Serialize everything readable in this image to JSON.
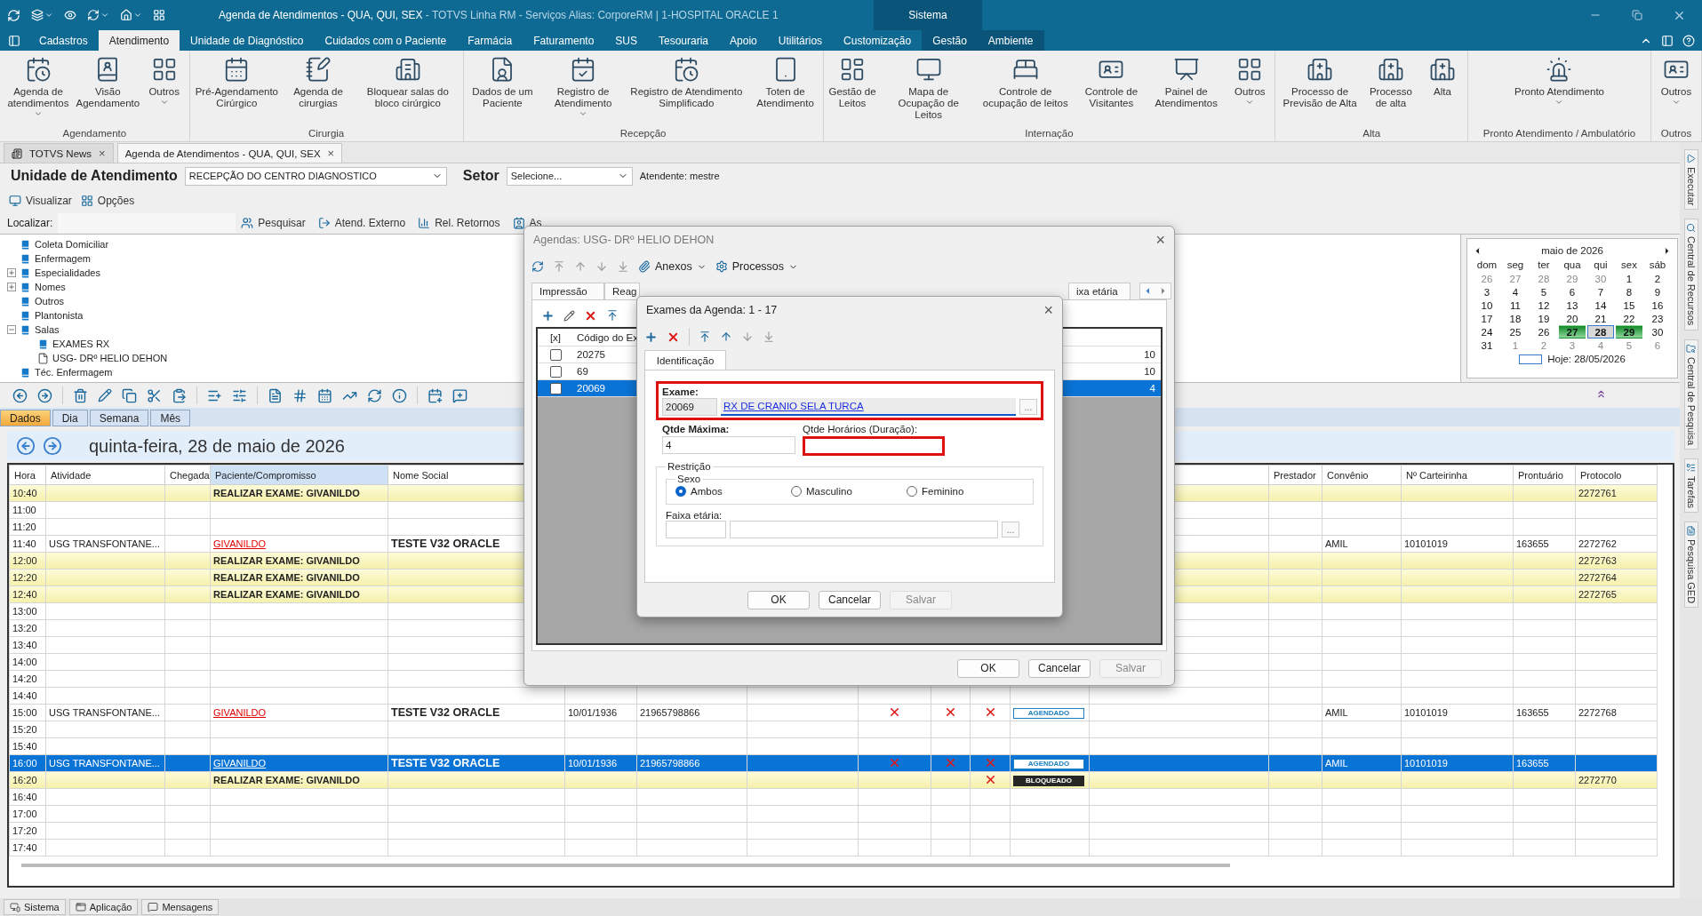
{
  "window": {
    "title": "Agenda de Atendimentos - QUA, QUI, SEX",
    "subtitle": " - TOTVS Linha RM - Serviços  Alias: CorporeRM | 1-HOSPITAL ORACLE 1",
    "context_tab": "Sistema"
  },
  "menu": [
    {
      "label": "Cadastros",
      "selected": false,
      "contextual": false
    },
    {
      "label": "Atendimento",
      "selected": true,
      "contextual": false
    },
    {
      "label": "Unidade de Diagnóstico",
      "selected": false,
      "contextual": false
    },
    {
      "label": "Cuidados com o Paciente",
      "selected": false,
      "contextual": false
    },
    {
      "label": "Farmácia",
      "selected": false,
      "contextual": false
    },
    {
      "label": "Faturamento",
      "selected": false,
      "contextual": false
    },
    {
      "label": "SUS",
      "selected": false,
      "contextual": false
    },
    {
      "label": "Tesouraria",
      "selected": false,
      "contextual": false
    },
    {
      "label": "Apoio",
      "selected": false,
      "contextual": false
    },
    {
      "label": "Utilitários",
      "selected": false,
      "contextual": false
    },
    {
      "label": "Customização",
      "selected": false,
      "contextual": false
    },
    {
      "label": "Gestão",
      "selected": false,
      "contextual": true
    },
    {
      "label": "Ambiente",
      "selected": false,
      "contextual": true
    }
  ],
  "ribbon": [
    {
      "label": "Agendamento",
      "items": [
        {
          "label": "Agenda de atendimentos",
          "dropdown": true
        },
        {
          "label": "Visão Agendamento",
          "dropdown": false
        },
        {
          "label": "Outros",
          "dropdown": true
        }
      ]
    },
    {
      "label": "Cirurgia",
      "items": [
        {
          "label": "Pré-Agendamento Cirúrgico",
          "dropdown": false
        },
        {
          "label": "Agenda de cirurgias",
          "dropdown": false
        },
        {
          "label": "Bloquear salas do bloco cirúrgico",
          "dropdown": false
        }
      ]
    },
    {
      "label": "Recepção",
      "items": [
        {
          "label": "Dados de um Paciente",
          "dropdown": false
        },
        {
          "label": "Registro de Atendimento",
          "dropdown": true
        },
        {
          "label": "Registro de Atendimento Simplificado",
          "dropdown": false
        },
        {
          "label": "Toten de Atendimento",
          "dropdown": false
        }
      ]
    },
    {
      "label": "Internação",
      "items": [
        {
          "label": "Gestão de Leitos",
          "dropdown": false
        },
        {
          "label": "Mapa de Ocupação de Leitos",
          "dropdown": false
        },
        {
          "label": "Controle de ocupação de leitos",
          "dropdown": false
        },
        {
          "label": "Controle de Visitantes",
          "dropdown": false
        },
        {
          "label": "Painel de Atendimentos",
          "dropdown": false
        },
        {
          "label": "Outros",
          "dropdown": true
        }
      ]
    },
    {
      "label": "Alta",
      "items": [
        {
          "label": "Processo de Previsão de Alta",
          "dropdown": false
        },
        {
          "label": "Processo de alta",
          "dropdown": false
        },
        {
          "label": "Alta",
          "dropdown": false
        }
      ]
    },
    {
      "label": "Pronto Atendimento / Ambulatório",
      "items": [
        {
          "label": "Pronto Atendimento",
          "dropdown": true
        }
      ]
    },
    {
      "label": "Outros",
      "items": [
        {
          "label": "Outros",
          "dropdown": true
        }
      ]
    }
  ],
  "doc_tabs": [
    {
      "label": "TOTVS News",
      "selected": false,
      "close": "×"
    },
    {
      "label": "Agenda de Atendimentos - QUA, QUI, SEX",
      "selected": true,
      "close": "×"
    }
  ],
  "unit": {
    "label": "Unidade de Atendimento",
    "value": "RECEPÇÃO DO CENTRO DIAGNOSTICO",
    "setor_label": "Setor",
    "setor_value": "Selecione...",
    "attendant": "Atendente: mestre"
  },
  "view_actions": [
    "Visualizar",
    "Opções"
  ],
  "locate": {
    "label": "Localizar:",
    "actions": [
      "Pesquisar",
      "Atend. Externo",
      "Rel. Retornos",
      "As"
    ]
  },
  "tree": [
    {
      "label": "Coleta Domiciliar",
      "kind": "book"
    },
    {
      "label": "Enfermagem",
      "kind": "book"
    },
    {
      "label": "Especialidades",
      "kind": "book",
      "expandable": true,
      "expanded": false
    },
    {
      "label": "Nomes",
      "kind": "book",
      "expandable": true,
      "expanded": false
    },
    {
      "label": "Outros",
      "kind": "book"
    },
    {
      "label": "Plantonista",
      "kind": "book"
    },
    {
      "label": "Salas",
      "kind": "book",
      "expandable": true,
      "expanded": true,
      "children": [
        {
          "label": "EXAMES RX",
          "kind": "book"
        },
        {
          "label": "USG- DRº HELIO DEHON",
          "kind": "page"
        }
      ]
    },
    {
      "label": "Téc. Enfermagem",
      "kind": "book"
    }
  ],
  "calendar": {
    "month": "maio de 2026",
    "weekdays": [
      "dom",
      "seg",
      "ter",
      "qua",
      "qui",
      "sex",
      "sáb"
    ],
    "weeks": [
      [
        {
          "d": "26",
          "outside": true,
          "marked": false,
          "selected": false
        },
        {
          "d": "27",
          "outside": true,
          "marked": false,
          "selected": false
        },
        {
          "d": "28",
          "outside": true,
          "marked": false,
          "selected": false
        },
        {
          "d": "29",
          "outside": true,
          "marked": false,
          "selected": false
        },
        {
          "d": "30",
          "outside": true,
          "marked": false,
          "selected": false
        },
        {
          "d": "1",
          "outside": false,
          "marked": false,
          "selected": false
        },
        {
          "d": "2",
          "outside": false,
          "marked": false,
          "selected": false
        }
      ],
      [
        {
          "d": "3",
          "outside": false,
          "marked": false,
          "selected": false
        },
        {
          "d": "4",
          "outside": false,
          "marked": false,
          "selected": false
        },
        {
          "d": "5",
          "outside": false,
          "marked": false,
          "selected": false
        },
        {
          "d": "6",
          "outside": false,
          "marked": false,
          "selected": false
        },
        {
          "d": "7",
          "outside": false,
          "marked": false,
          "selected": false
        },
        {
          "d": "8",
          "outside": false,
          "marked": false,
          "selected": false
        },
        {
          "d": "9",
          "outside": false,
          "marked": false,
          "selected": false
        }
      ],
      [
        {
          "d": "10",
          "outside": false,
          "marked": false,
          "selected": false
        },
        {
          "d": "11",
          "outside": false,
          "marked": false,
          "selected": false
        },
        {
          "d": "12",
          "outside": false,
          "marked": false,
          "selected": false
        },
        {
          "d": "13",
          "outside": false,
          "marked": false,
          "selected": false
        },
        {
          "d": "14",
          "outside": false,
          "marked": false,
          "selected": false
        },
        {
          "d": "15",
          "outside": false,
          "marked": false,
          "selected": false
        },
        {
          "d": "16",
          "outside": false,
          "marked": false,
          "selected": false
        }
      ],
      [
        {
          "d": "17",
          "outside": false,
          "marked": false,
          "selected": false
        },
        {
          "d": "18",
          "outside": false,
          "marked": false,
          "selected": false
        },
        {
          "d": "19",
          "outside": false,
          "marked": false,
          "selected": false
        },
        {
          "d": "20",
          "outside": false,
          "marked": false,
          "selected": false
        },
        {
          "d": "21",
          "outside": false,
          "marked": false,
          "selected": false
        },
        {
          "d": "22",
          "outside": false,
          "marked": false,
          "selected": false
        },
        {
          "d": "23",
          "outside": false,
          "marked": false,
          "selected": false
        }
      ],
      [
        {
          "d": "24",
          "outside": false,
          "marked": false,
          "selected": false
        },
        {
          "d": "25",
          "outside": false,
          "marked": false,
          "selected": false
        },
        {
          "d": "26",
          "outside": false,
          "marked": false,
          "selected": false
        },
        {
          "d": "27",
          "outside": false,
          "marked": true,
          "selected": false
        },
        {
          "d": "28",
          "outside": false,
          "marked": false,
          "selected": true
        },
        {
          "d": "29",
          "outside": false,
          "marked": true,
          "selected": false
        },
        {
          "d": "30",
          "outside": false,
          "marked": false,
          "selected": false
        }
      ],
      [
        {
          "d": "31",
          "outside": false,
          "marked": false,
          "selected": false
        },
        {
          "d": "1",
          "outside": true,
          "marked": false,
          "selected": false
        },
        {
          "d": "2",
          "outside": true,
          "marked": false,
          "selected": false
        },
        {
          "d": "3",
          "outside": true,
          "marked": false,
          "selected": false
        },
        {
          "d": "4",
          "outside": true,
          "marked": false,
          "selected": false
        },
        {
          "d": "5",
          "outside": true,
          "marked": false,
          "selected": false
        },
        {
          "d": "6",
          "outside": true,
          "marked": false,
          "selected": false
        }
      ]
    ],
    "today": "Hoje: 28/05/2026"
  },
  "view_tabs": [
    {
      "label": "Dados",
      "selected": true
    },
    {
      "label": "Dia",
      "selected": false
    },
    {
      "label": "Semana",
      "selected": false
    },
    {
      "label": "Mês",
      "selected": false
    }
  ],
  "date_title": "quinta-feira, 28 de maio de 2026",
  "columns": [
    {
      "label": "Hora",
      "sorted": false
    },
    {
      "label": "Atividade",
      "sorted": false
    },
    {
      "label": "Chegada",
      "sorted": false
    },
    {
      "label": "Paciente/Compromisso",
      "sorted": true
    },
    {
      "label": "Nome Social",
      "sorted": false
    },
    {
      "label": "Prestador",
      "sorted": false
    },
    {
      "label": "Convênio",
      "sorted": false
    },
    {
      "label": "Nº Carteirinha",
      "sorted": false
    },
    {
      "label": "Prontuário",
      "sorted": false
    },
    {
      "label": "Protocolo",
      "sorted": false
    }
  ],
  "rows": [
    {
      "hora": "10:40",
      "kind": "blocked",
      "selected": false,
      "paciente": "REALIZAR EXAME: GIVANILDO",
      "protocolo": "2272761"
    },
    {
      "hora": "11:00",
      "kind": "empty",
      "selected": false
    },
    {
      "hora": "11:20",
      "kind": "empty",
      "selected": false
    },
    {
      "hora": "11:40",
      "kind": "patient",
      "selected": false,
      "atividade": "USG TRANSFONTANE...",
      "paciente": "GIVANILDO",
      "nome_social": "TESTE V32 ORACLE",
      "convenio": "AMIL",
      "carteirinha": "10101019",
      "prontuario": "163655",
      "protocolo": "2272762"
    },
    {
      "hora": "12:00",
      "kind": "blocked",
      "selected": false,
      "paciente": "REALIZAR EXAME: GIVANILDO",
      "protocolo": "2272763"
    },
    {
      "hora": "12:20",
      "kind": "blocked",
      "selected": false,
      "paciente": "REALIZAR EXAME: GIVANILDO",
      "protocolo": "2272764"
    },
    {
      "hora": "12:40",
      "kind": "blocked",
      "selected": false,
      "paciente": "REALIZAR EXAME: GIVANILDO",
      "protocolo": "2272765"
    },
    {
      "hora": "13:00",
      "kind": "empty",
      "selected": false
    },
    {
      "hora": "13:20",
      "kind": "empty",
      "selected": false
    },
    {
      "hora": "13:40",
      "kind": "empty",
      "selected": false
    },
    {
      "hora": "14:00",
      "kind": "empty",
      "selected": false
    },
    {
      "hora": "14:20",
      "kind": "empty",
      "selected": false
    },
    {
      "hora": "14:40",
      "kind": "empty",
      "selected": false
    },
    {
      "hora": "15:00",
      "kind": "patient",
      "selected": false,
      "atividade": "USG TRANSFONTANE...",
      "paciente": "GIVANILDO",
      "nome_social": "TESTE V32 ORACLE",
      "nascimento": "10/01/1936",
      "telefone": "21965798866",
      "marks": [
        true,
        true,
        true
      ],
      "status": {
        "label": "AGENDADO",
        "kind": "scheduled"
      },
      "convenio": "AMIL",
      "carteirinha": "10101019",
      "prontuario": "163655",
      "protocolo": "2272768"
    },
    {
      "hora": "15:20",
      "kind": "empty",
      "selected": false
    },
    {
      "hora": "15:40",
      "kind": "empty",
      "selected": false
    },
    {
      "hora": "16:00",
      "kind": "patient",
      "selected": true,
      "atividade": "USG TRANSFONTANE...",
      "paciente": "GIVANILDO",
      "nome_social": "TESTE V32 ORACLE",
      "nascimento": "10/01/1936",
      "telefone": "21965798866",
      "marks": [
        true,
        true,
        true
      ],
      "status": {
        "label": "AGENDADO",
        "kind": "scheduled"
      },
      "convenio": "AMIL",
      "carteirinha": "10101019",
      "prontuario": "163655"
    },
    {
      "hora": "16:20",
      "kind": "blocked",
      "selected": false,
      "paciente": "REALIZAR EXAME: GIVANILDO",
      "marks": [
        false,
        false,
        true
      ],
      "status": {
        "label": "BLOQUEADO",
        "kind": "blocked"
      },
      "protocolo": "2272770"
    },
    {
      "hora": "16:40",
      "kind": "empty",
      "selected": false
    },
    {
      "hora": "17:00",
      "kind": "empty",
      "selected": false
    },
    {
      "hora": "17:20",
      "kind": "empty",
      "selected": false
    },
    {
      "hora": "17:40",
      "kind": "empty",
      "selected": false
    }
  ],
  "side_tabs": [
    "Executar",
    "Central de Recursos",
    "Central de Pesquisa",
    "Tarefas",
    "Pesquisa GED"
  ],
  "status_bar": [
    "Sistema",
    "Aplicação",
    "Mensagens"
  ],
  "agenda_dialog": {
    "title": "Agendas: USG- DRº HELIO DEHON",
    "close": "×",
    "tools": [
      "Anexos",
      "Processos"
    ],
    "tabs": [
      "Impressão",
      "Reag",
      "ixa etária"
    ],
    "grid_columns": [
      "[x]",
      "Código do Ex"
    ],
    "grid_rows": [
      {
        "code": "20275",
        "value": "10",
        "checked": false,
        "selected": false
      },
      {
        "code": "69",
        "value": "10",
        "checked": false,
        "selected": false
      },
      {
        "code": "20069",
        "value": "4",
        "checked": false,
        "selected": true
      }
    ],
    "buttons": [
      {
        "label": "OK",
        "disabled": false
      },
      {
        "label": "Cancelar",
        "disabled": false
      },
      {
        "label": "Salvar",
        "disabled": true
      }
    ]
  },
  "exam_dialog": {
    "title": "Exames da Agenda: 1 - 17",
    "close": "×",
    "tab": "Identificação",
    "exam_label": "Exame:",
    "exam_code": "20069",
    "exam_name": "RX DE CRANIO SELA TURCA",
    "exam_highlighted": true,
    "lookup": "...",
    "max_label": "Qtde Máxima:",
    "max_value": "4",
    "slots_label": "Qtde Horários (Duração):",
    "slots_highlighted": true,
    "restriction": "Restrição",
    "sex_label": "Sexo",
    "sex_options": [
      {
        "label": "Ambos",
        "selected": true
      },
      {
        "label": "Masculino",
        "selected": false
      },
      {
        "label": "Feminino",
        "selected": false
      }
    ],
    "age_label": "Faixa etária:",
    "age_lookup": "...",
    "buttons": [
      {
        "label": "OK",
        "disabled": false
      },
      {
        "label": "Cancelar",
        "disabled": false
      },
      {
        "label": "Salvar",
        "disabled": true
      }
    ]
  }
}
